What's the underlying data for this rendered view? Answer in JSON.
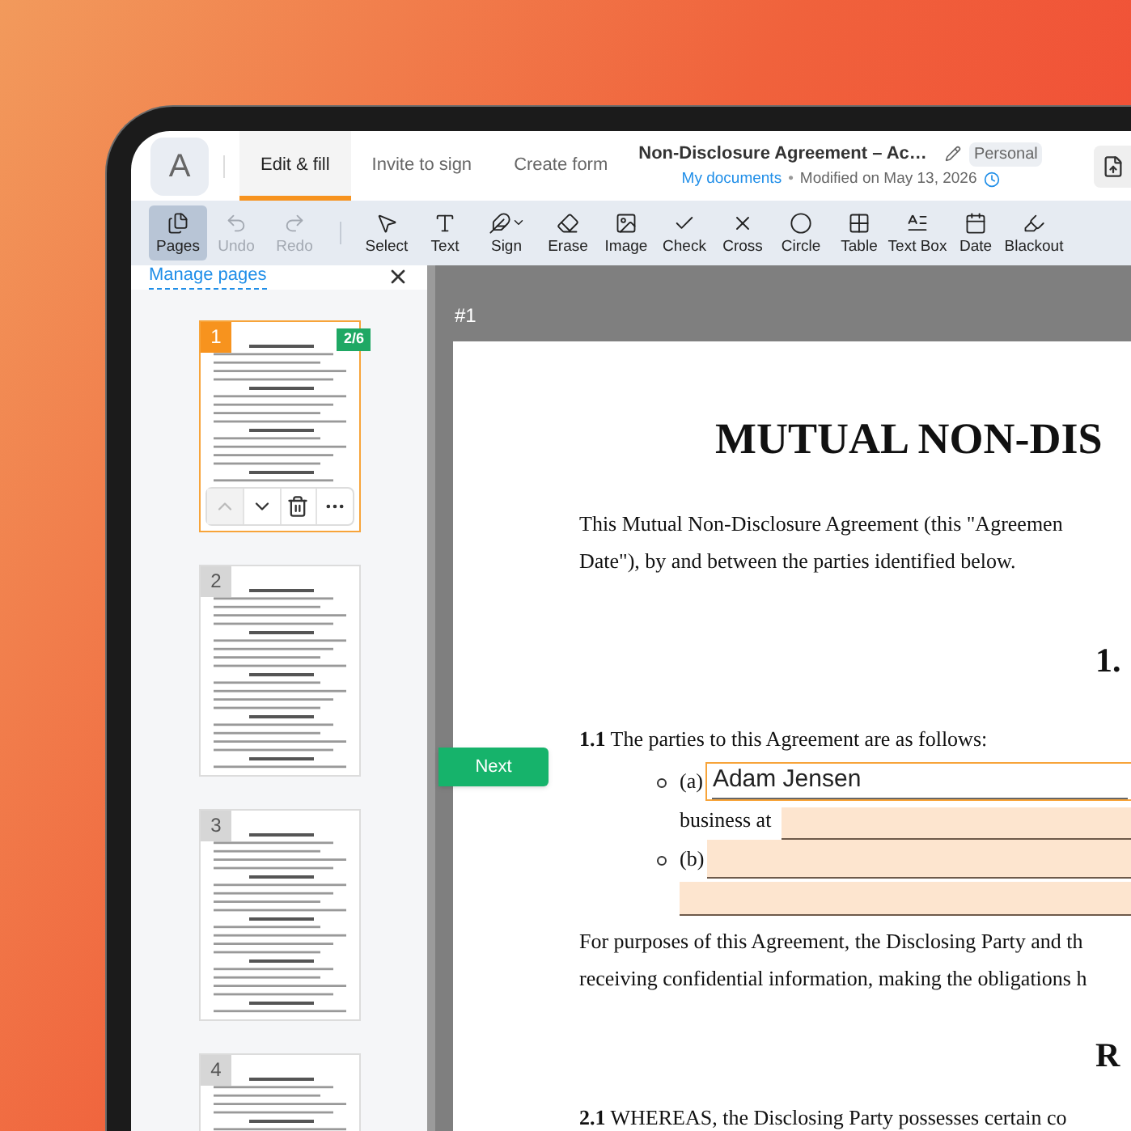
{
  "header": {
    "logo": "A",
    "tabs": [
      {
        "label": "Edit & fill",
        "selected": true
      },
      {
        "label": "Invite to sign",
        "selected": false
      },
      {
        "label": "Create form",
        "selected": false
      }
    ],
    "document": {
      "title": "Non-Disclosure Agreement – Ac…",
      "badge": "Personal",
      "location": "My documents",
      "separator": "•",
      "modified": "Modified on May 13, 2026"
    }
  },
  "toolbar": {
    "items": [
      {
        "label": "Pages",
        "selected": true,
        "disabled": false,
        "has_menu": false
      },
      {
        "label": "Undo",
        "selected": false,
        "disabled": true,
        "has_menu": false
      },
      {
        "label": "Redo",
        "selected": false,
        "disabled": true,
        "has_menu": false
      },
      {
        "label": "Select",
        "selected": false,
        "disabled": false,
        "has_menu": false
      },
      {
        "label": "Text",
        "selected": false,
        "disabled": false,
        "has_menu": false
      },
      {
        "label": "Sign",
        "selected": false,
        "disabled": false,
        "has_menu": true
      },
      {
        "label": "Erase",
        "selected": false,
        "disabled": false,
        "has_menu": false
      },
      {
        "label": "Image",
        "selected": false,
        "disabled": false,
        "has_menu": false
      },
      {
        "label": "Check",
        "selected": false,
        "disabled": false,
        "has_menu": false
      },
      {
        "label": "Cross",
        "selected": false,
        "disabled": false,
        "has_menu": false
      },
      {
        "label": "Circle",
        "selected": false,
        "disabled": false,
        "has_menu": false
      },
      {
        "label": "Table",
        "selected": false,
        "disabled": false,
        "has_menu": false
      },
      {
        "label": "Text Box",
        "selected": false,
        "disabled": false,
        "has_menu": false
      },
      {
        "label": "Date",
        "selected": false,
        "disabled": false,
        "has_menu": false
      },
      {
        "label": "Blackout",
        "selected": false,
        "disabled": false,
        "has_menu": false
      }
    ]
  },
  "pages_panel": {
    "title": "Manage pages",
    "thumbnails": [
      {
        "number": "1",
        "selected": true,
        "badge": "2/6"
      },
      {
        "number": "2",
        "selected": false
      },
      {
        "number": "3",
        "selected": false
      },
      {
        "number": "4",
        "selected": false
      }
    ],
    "page_actions": [
      {
        "kind": "up",
        "disabled": true
      },
      {
        "kind": "down",
        "disabled": false
      },
      {
        "kind": "delete",
        "disabled": false
      },
      {
        "kind": "more",
        "disabled": false
      }
    ]
  },
  "next_button": "Next",
  "document": {
    "page_label": "#1",
    "title": "MUTUAL NON-DIS",
    "intro": [
      "This Mutual Non-Disclosure Agreement (this \"Agreemen",
      "Date\"), by and between the parties identified below."
    ],
    "section_heading": "1.",
    "clause": "**1.1** The parties to this Agreement are as follows:",
    "parties": [
      {
        "label": "(a)",
        "value": "Adam Jensen",
        "focused": true,
        "continuation": "business at"
      },
      {
        "label": "(b)",
        "focused": false
      }
    ],
    "paragraph": [
      "For purposes of this Agreement, the Disclosing Party and th",
      "receiving confidential information, making the obligations h"
    ],
    "section_heading_2": "R",
    "clause_2": "**2.1** WHEREAS, the Disclosing Party possesses certain co"
  }
}
